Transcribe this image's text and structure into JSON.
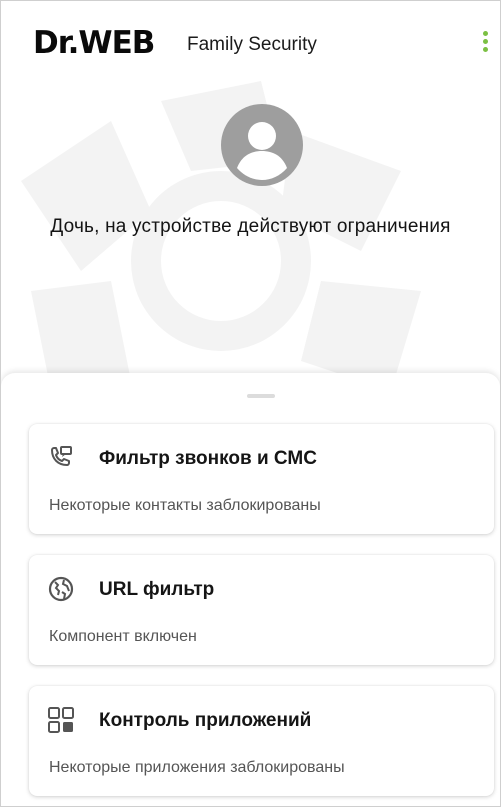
{
  "header": {
    "logo_text": "Dr.WEB",
    "app_name": "Family Security",
    "menu_icon": "more-vert-icon",
    "accent_color": "#7bc043"
  },
  "profile": {
    "avatar_icon": "account-circle-icon",
    "status_text": "Дочь, на устройстве действуют ограничения"
  },
  "cards": [
    {
      "icon": "call-filter-icon",
      "title": "Фильтр звонков и СМС",
      "subtitle": "Некоторые контакты заблокированы"
    },
    {
      "icon": "globe-icon",
      "title": "URL фильтр",
      "subtitle": "Компонент включен"
    },
    {
      "icon": "apps-grid-icon",
      "title": "Контроль приложений",
      "subtitle": "Некоторые приложения заблокированы"
    }
  ]
}
